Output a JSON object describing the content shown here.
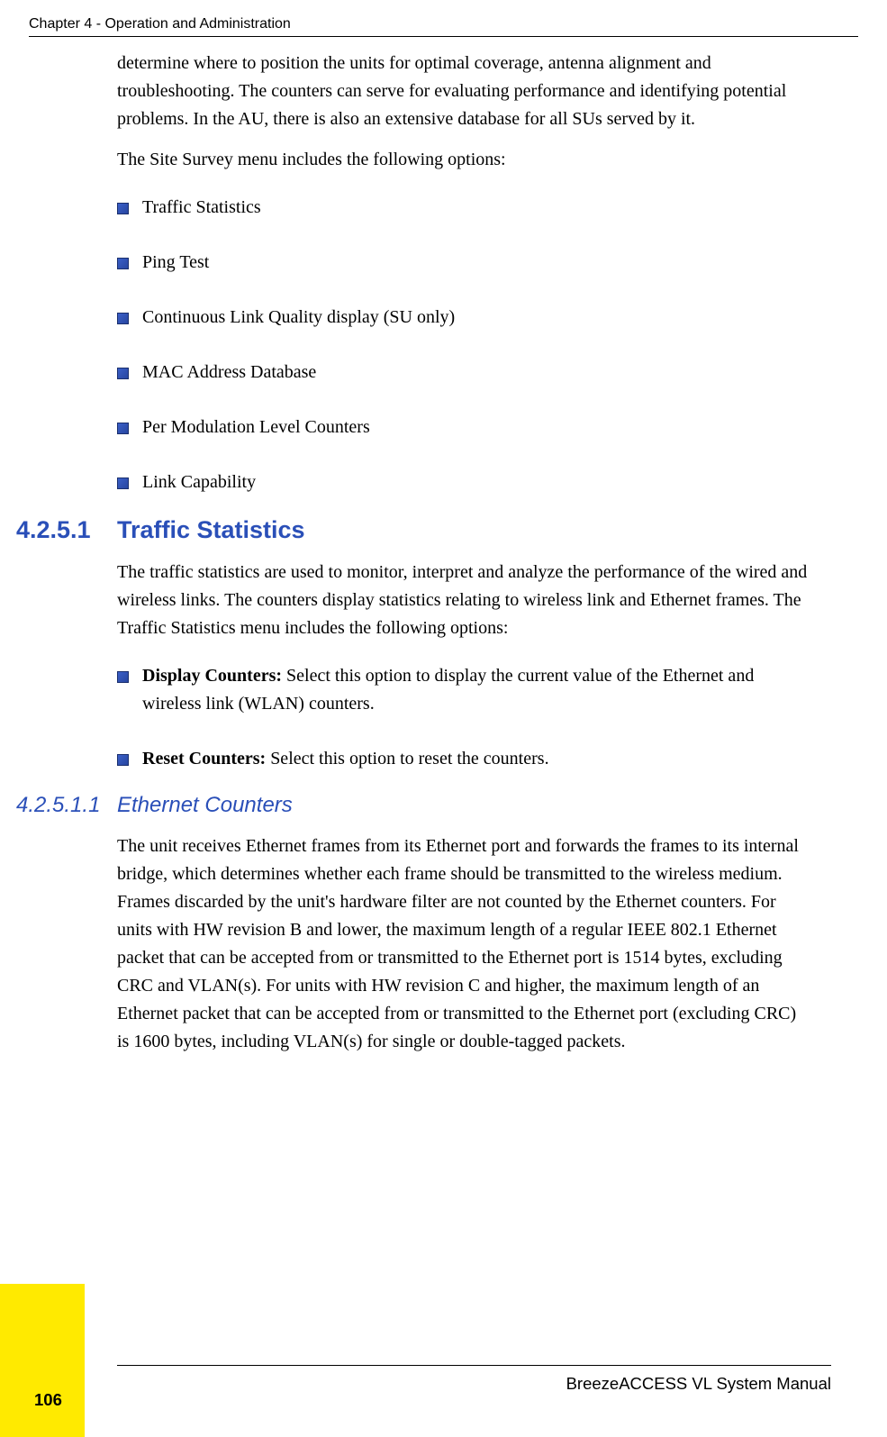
{
  "header": "Chapter 4 - Operation and Administration",
  "intro": {
    "p1": "determine where to position the units for optimal coverage, antenna alignment and troubleshooting. The counters can serve for evaluating performance and identifying potential problems. In the AU, there is also an extensive database for all SUs served by it.",
    "p2": "The Site Survey menu includes the following options:"
  },
  "bullets1": [
    "Traffic Statistics",
    "Ping Test",
    "Continuous Link Quality display (SU only)",
    "MAC Address Database",
    "Per Modulation Level Counters",
    "Link Capability"
  ],
  "sec1": {
    "num": "4.2.5.1",
    "title": "Traffic Statistics",
    "para": "The traffic statistics are used to monitor, interpret and analyze the performance of the wired and wireless links. The counters display statistics relating to wireless link and Ethernet frames. The Traffic Statistics menu includes the following options:"
  },
  "bullets2": [
    {
      "bold": "Display Counters:",
      "rest": " Select this option to display the current value of the Ethernet and wireless link (WLAN) counters."
    },
    {
      "bold": "Reset Counters:",
      "rest": " Select this option to reset the counters."
    }
  ],
  "sec2": {
    "num": "4.2.5.1.1",
    "title": "Ethernet Counters",
    "para": "The unit receives Ethernet frames from its Ethernet port and forwards the frames to its internal bridge, which determines whether each frame should be transmitted to the wireless medium. Frames discarded by the unit's hardware filter are not counted by the Ethernet counters. For units with HW revision B and lower, the maximum length of a regular IEEE 802.1 Ethernet packet that can be accepted from or transmitted to the Ethernet port is 1514 bytes, excluding CRC and VLAN(s). For units with HW revision C and higher, the maximum length of an Ethernet packet that can be accepted from or transmitted to the Ethernet port (excluding CRC) is 1600 bytes, including VLAN(s) for single or double-tagged packets."
  },
  "footer": "BreezeACCESS VL System Manual",
  "pagenum": "106"
}
